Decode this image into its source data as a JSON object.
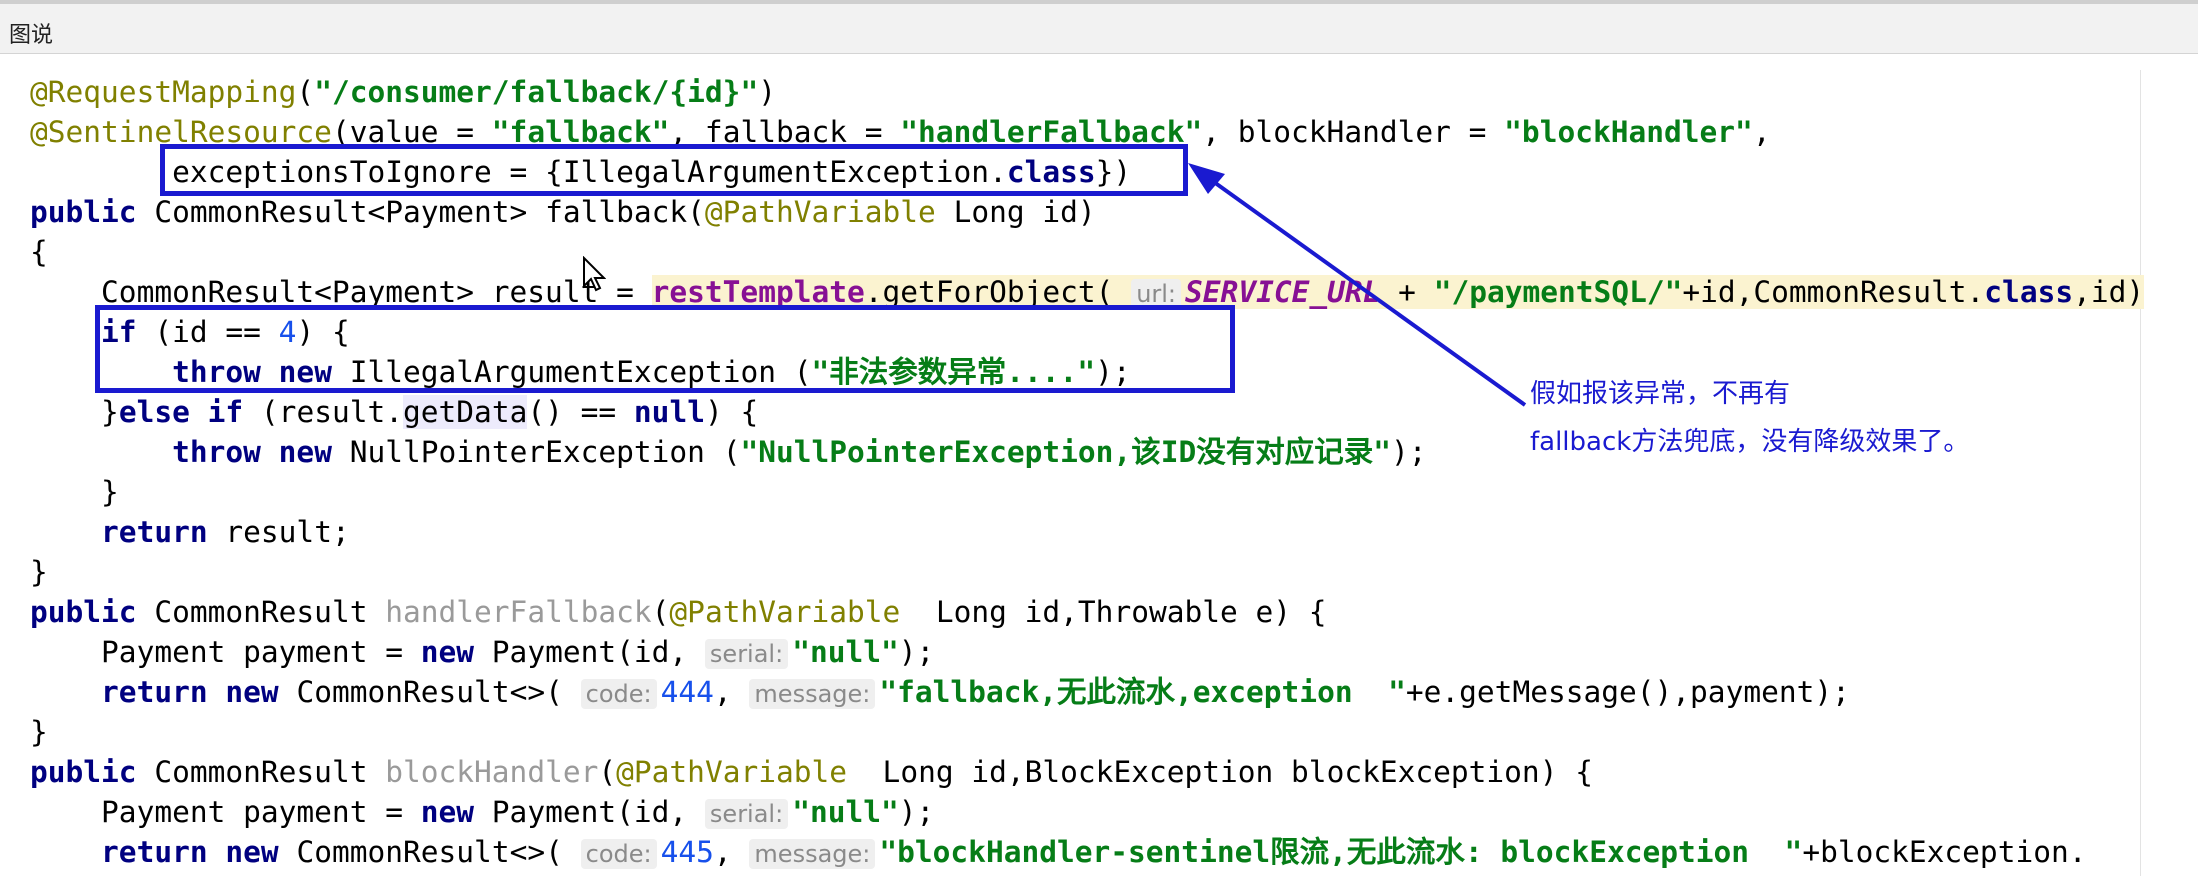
{
  "window": {
    "title": "图说"
  },
  "code": {
    "l1": {
      "ann": "@RequestMapping",
      "p1": "(",
      "s1": "\"/consumer/fallback/{id}\"",
      "p2": ")"
    },
    "l2": {
      "ann": "@SentinelResource",
      "t1": "(value = ",
      "s1": "\"fallback\"",
      "t2": ", fallback = ",
      "s2": "\"handlerFallback\"",
      "t3": ", blockHandler = ",
      "s3": "\"blockHandler\"",
      "t4": ","
    },
    "l3": {
      "t1": "        exceptionsToIgnore = {IllegalArgumentException.",
      "kw": "class",
      "t2": "})"
    },
    "l4": {
      "kw": "public",
      "t1": " CommonResult<Payment> fallback(",
      "ann": "@PathVariable",
      "t2": " Long id)"
    },
    "l5": {
      "t1": "{"
    },
    "l6": {
      "t1": "    CommonResult<Payment> result = ",
      "rt": "restTemplate",
      "t2": ".getForObject( ",
      "hint": "url:",
      "fld": "SERVICE_URL",
      "t3": " + ",
      "s1": "\"/paymentSQL/\"",
      "t4": "+id,CommonResult.",
      "kw": "class",
      "t5": ",id)"
    },
    "l7": {
      "kw": "if",
      "t1": " (id == ",
      "num": "4",
      "t2": ") {"
    },
    "l8": {
      "kw1": "throw",
      "kw2": "new",
      "t1": " IllegalArgumentException (",
      "s1": "\"非法参数异常....\"",
      "t2": ");"
    },
    "l9": {
      "t1": "    }",
      "kw1": "else",
      "kw2": "if",
      "t2": " (result.",
      "m": "getData",
      "t3": "() == ",
      "kw3": "null",
      "t4": ") {"
    },
    "l10": {
      "kw1": "throw",
      "kw2": "new",
      "t1": " NullPointerException (",
      "s1": "\"NullPointerException,该ID没有对应记录\"",
      "t2": ");"
    },
    "l11": {
      "t1": "    }"
    },
    "l12": {
      "kw": "return",
      "t1": " result;"
    },
    "l13": {
      "t1": "}"
    },
    "l14": {
      "kw": "public",
      "t1": " CommonResult ",
      "g": "handlerFallback",
      "t2": "(",
      "ann": "@PathVariable",
      "t3": "  Long id,Throwable e) {"
    },
    "l15": {
      "t1": "    Payment payment = ",
      "kw": "new",
      "t2": " Payment(id, ",
      "hint": "serial:",
      "s1": "\"null\"",
      "t3": ");"
    },
    "l16": {
      "kw1": "return",
      "kw2": "new",
      "t1": " CommonResult<>( ",
      "hint1": "code:",
      "num": "444",
      "t2": ", ",
      "hint2": "message:",
      "s1": "\"fallback,无此流水,exception  \"",
      "t3": "+e.getMessage(),payment);"
    },
    "l17": {
      "t1": "}"
    },
    "l18": {
      "kw": "public",
      "t1": " CommonResult ",
      "g": "blockHandler",
      "t2": "(",
      "ann": "@PathVariable",
      "t3": "  Long id,BlockException blockException) {"
    },
    "l19": {
      "t1": "    Payment payment = ",
      "kw": "new",
      "t2": " Payment(id, ",
      "hint": "serial:",
      "s1": "\"null\"",
      "t3": ");"
    },
    "l20": {
      "kw1": "return",
      "kw2": "new",
      "t1": " CommonResult<>( ",
      "hint1": "code:",
      "num": "445",
      "t2": ", ",
      "hint2": "message:",
      "s1": "\"blockHandler-sentinel限流,无此流水: blockException  \"",
      "t3": "+blockException."
    }
  },
  "annotation": {
    "line1": "假如报该异常，不再有",
    "line2": "fallback方法兜底，没有降级效果了。",
    "color": "#1a1ad0"
  }
}
